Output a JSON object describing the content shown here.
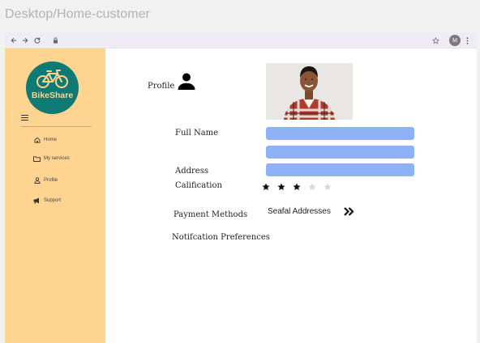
{
  "frame": {
    "title": "Desktop/Home-customer"
  },
  "browser": {
    "avatar_initial": "M"
  },
  "sidebar": {
    "logo_text": "BikeShare",
    "items": [
      {
        "label": "Home",
        "icon": "home-icon"
      },
      {
        "label": "My services",
        "icon": "folder-icon"
      },
      {
        "label": "Profile",
        "icon": "user-icon"
      },
      {
        "label": "Support",
        "icon": "megaphone-icon"
      }
    ]
  },
  "main": {
    "profile_label": "Profile",
    "fields": {
      "full_name_label": "Full Name",
      "full_name_value": "",
      "second_value": "",
      "address_label": "Address",
      "address_value": ""
    },
    "rating": {
      "label": "Calification",
      "value": 3,
      "max": 5
    },
    "payment_label": "Payment Methods",
    "addresses_label": "Seafal Addresses",
    "notifications_label": "Notifcation Preferences"
  },
  "colors": {
    "sidebar_bg": "#ffd491",
    "logo_bg": "#0f7a74",
    "field_bg": "#8fb2f7",
    "star_filled": "#111111",
    "star_empty": "#d9d9d9"
  }
}
